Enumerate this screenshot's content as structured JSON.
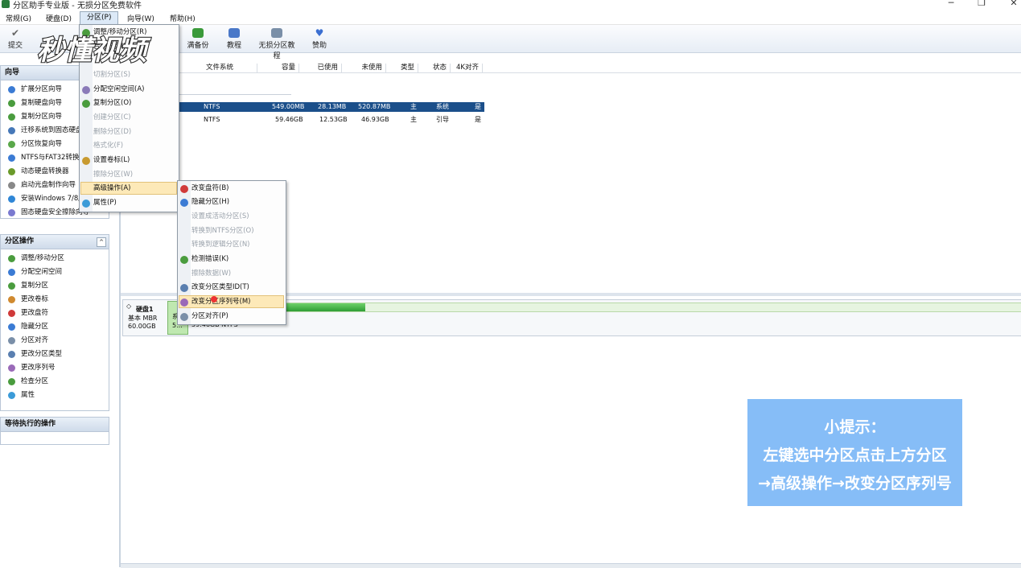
{
  "window": {
    "title": "分区助手专业版 - 无损分区免费软件",
    "controls": [
      "minimize-icon",
      "restore-icon",
      "close-icon"
    ]
  },
  "menubar": [
    "常规(G)",
    "硬盘(D)",
    "分区(P)",
    "向导(W)",
    "帮助(H)"
  ],
  "toolbar": [
    "提交",
    "满备份",
    "教程",
    "无损分区教程",
    "赞助"
  ],
  "wizard_panel": {
    "title": "向导",
    "items": [
      "扩展分区向导",
      "复制硬盘向导",
      "复制分区向导",
      "迁移系统到固态硬盘",
      "分区恢复向导",
      "NTFS与FAT32转换器",
      "动态硬盘转换器",
      "启动光盘制作向导",
      "安装Windows 7/8/10",
      "固态硬盘安全擦除向导"
    ]
  },
  "ops_panel": {
    "title": "分区操作",
    "collapse": "^",
    "items": [
      "调整/移动分区",
      "分配空闲空间",
      "复制分区",
      "更改卷标",
      "更改盘符",
      "隐藏分区",
      "分区对齐",
      "更改分区类型",
      "更改序列号",
      "检查分区",
      "属性"
    ]
  },
  "pending_panel": {
    "title": "等待执行的操作"
  },
  "table": {
    "headers": [
      "文件系统",
      "容量",
      "已使用",
      "未使用",
      "类型",
      "状态",
      "4K对齐"
    ],
    "rows": [
      {
        "fs": "NTFS",
        "cap": "549.00MB",
        "used": "28.13MB",
        "free": "520.87MB",
        "type": "主",
        "status": "系统",
        "align": "是",
        "selected": true
      },
      {
        "fs": "NTFS",
        "cap": "59.46GB",
        "used": "12.53GB",
        "free": "46.93GB",
        "type": "主",
        "status": "引导",
        "align": "是",
        "selected": false
      }
    ]
  },
  "disk_map": {
    "disk_name": "硬盘1",
    "disk_type": "基本 MBR",
    "disk_size": "60.00GB",
    "small_label_1": "系",
    "small_label_2": "5...",
    "part_label": "59.46GB NTFS",
    "used_fraction": 0.107
  },
  "partition_menu": {
    "items": [
      {
        "label": "调整/移动分区(R)",
        "disabled": false
      },
      {
        "label": "合并分区(M)",
        "disabled": false
      },
      {
        "label": "切割分区(S)",
        "disabled": true
      },
      {
        "label": "分配空闲空间(A)",
        "disabled": false
      },
      {
        "label": "复制分区(O)",
        "disabled": false
      },
      {
        "label": "创建分区(C)",
        "disabled": true
      },
      {
        "label": "删除分区(D)",
        "disabled": true
      },
      {
        "label": "格式化(F)",
        "disabled": true
      },
      {
        "label": "设置卷标(L)",
        "disabled": false
      },
      {
        "label": "擦除分区(W)",
        "disabled": true
      },
      {
        "label": "高级操作(A)",
        "disabled": false,
        "highlighted": true
      },
      {
        "label": "属性(P)",
        "disabled": false
      }
    ]
  },
  "advanced_submenu": {
    "items": [
      {
        "label": "改变盘符(B)",
        "disabled": false
      },
      {
        "label": "隐藏分区(H)",
        "disabled": false
      },
      {
        "label": "设置成活动分区(S)",
        "disabled": true
      },
      {
        "label": "转换到NTFS分区(O)",
        "disabled": true
      },
      {
        "label": "转换到逻辑分区(N)",
        "disabled": true
      },
      {
        "label": "检测错误(K)",
        "disabled": false
      },
      {
        "label": "擦除数据(W)",
        "disabled": true
      },
      {
        "label": "改变分区类型ID(T)",
        "disabled": false
      },
      {
        "label": "改变分区序列号(M)",
        "disabled": false,
        "highlighted": true
      },
      {
        "label": "分区对齐(P)",
        "disabled": false
      }
    ]
  },
  "hint": {
    "line1": "小提示：",
    "line2": "左键选中分区点击上方分区",
    "line3": "→高级操作→改变分区序列号"
  },
  "watermark": {
    "text": "秒懂视频"
  }
}
